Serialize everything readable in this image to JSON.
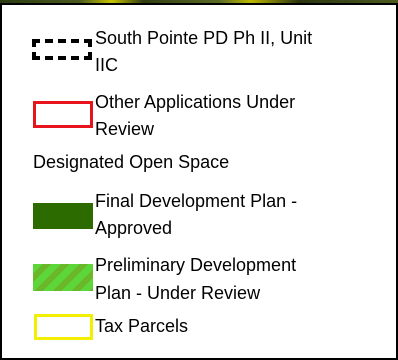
{
  "legend": {
    "items": [
      {
        "id": "south-pointe",
        "line1": "South Pointe PD Ph II, Unit",
        "line2": "IIC",
        "symbol": "dashed-black-outline",
        "color": "#000000"
      },
      {
        "id": "other-applications",
        "line1": "Other Applications Under",
        "line2": "Review",
        "symbol": "red-outline",
        "color": "#e8141b"
      },
      {
        "id": "open-space",
        "line1": "Designated Open Space",
        "symbol": "none"
      },
      {
        "id": "final-development",
        "line1": "Final Development Plan -",
        "line2": "Approved",
        "symbol": "solid-fill",
        "color": "#2c6b00"
      },
      {
        "id": "preliminary-development",
        "line1": "Preliminary Development",
        "line2": "Plan - Under Review",
        "symbol": "hatched-fill",
        "color": "#5dd63a"
      },
      {
        "id": "tax-parcels",
        "line1": "Tax Parcels",
        "symbol": "yellow-outline",
        "color": "#f2f000"
      }
    ]
  }
}
